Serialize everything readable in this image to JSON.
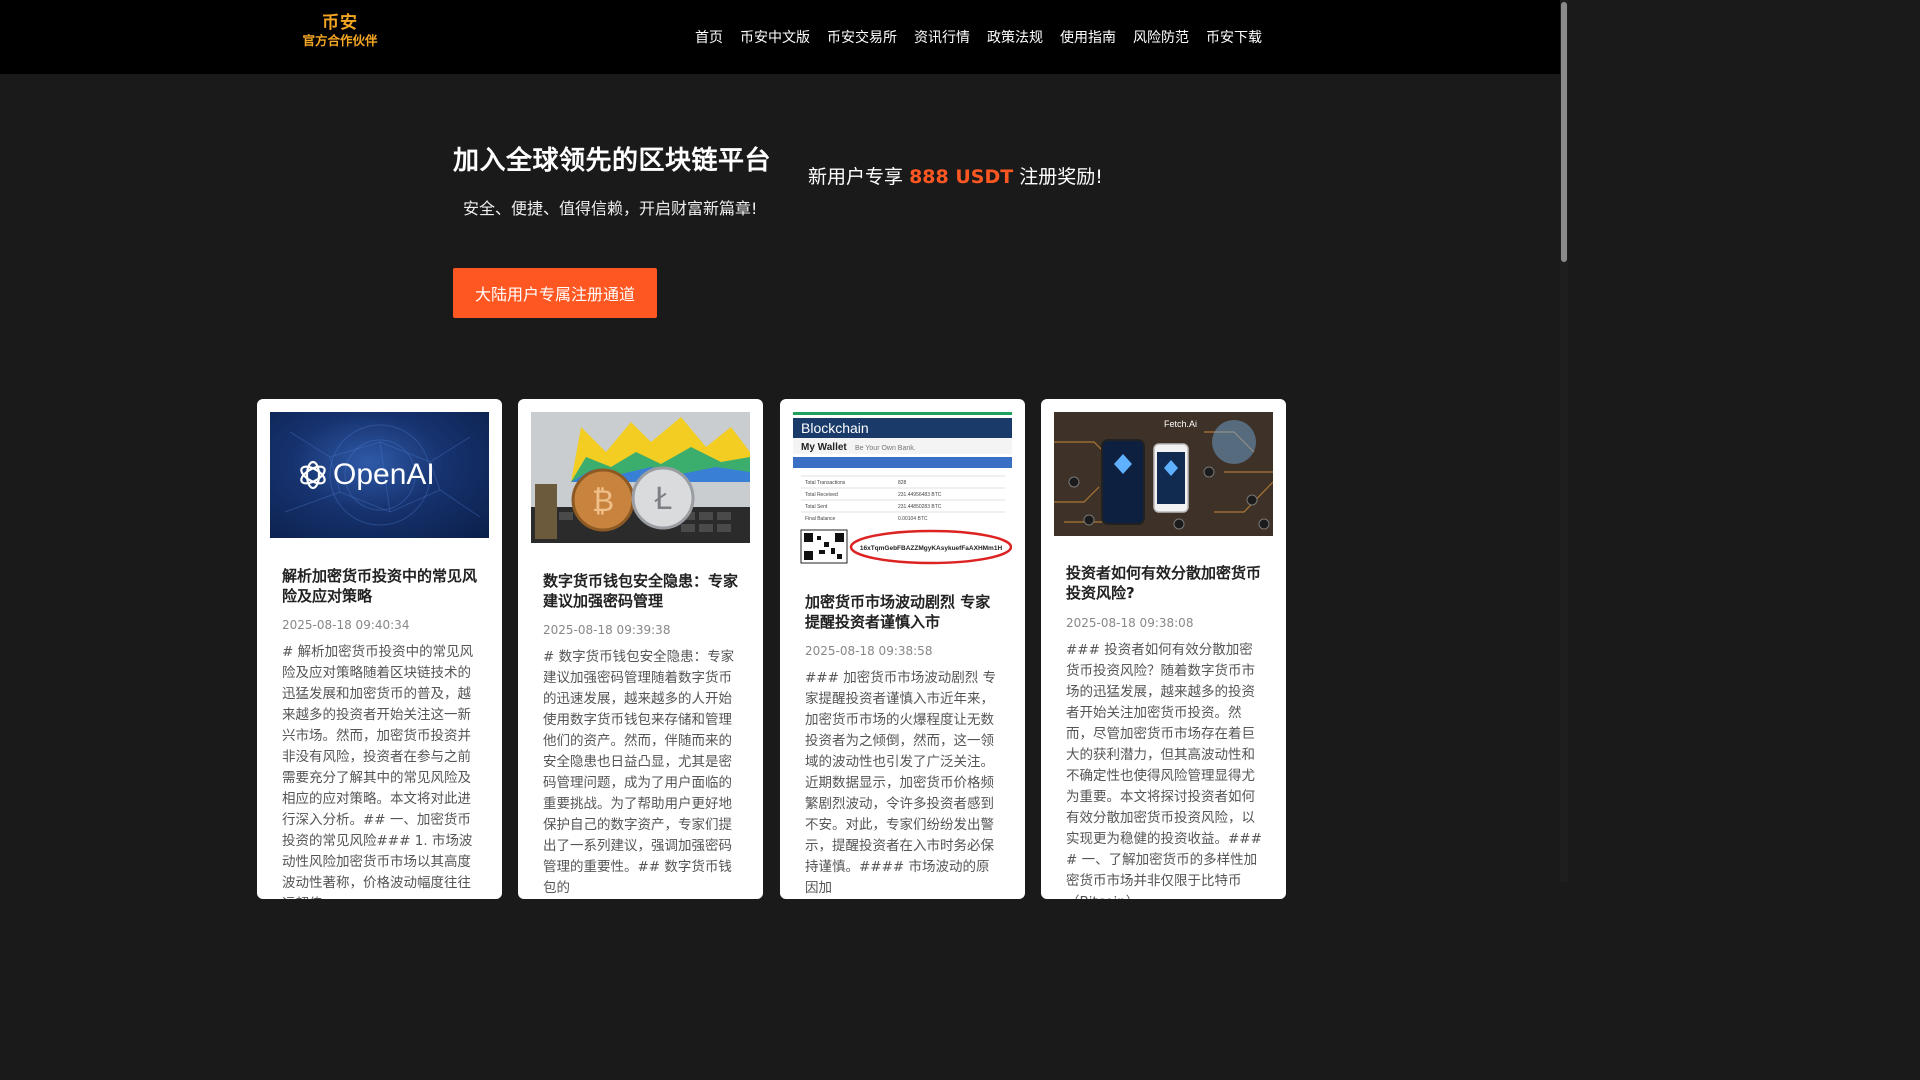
{
  "header": {
    "logo_line1": "币安",
    "logo_line2": "官方合作伙伴",
    "nav": [
      "首页",
      "币安中文版",
      "币安交易所",
      "资讯行情",
      "政策法规",
      "使用指南",
      "风险防范",
      "币安下载"
    ]
  },
  "hero": {
    "title": "加入全球领先的区块链平台",
    "subtitle": "安全、便捷、值得信赖，开启财富新篇章!",
    "promo_prefix": "新用户专享",
    "promo_highlight": "888 USDT",
    "promo_suffix": "注册奖励!",
    "cta_label": "大陆用户专属注册通道"
  },
  "cards": [
    {
      "image_text": "OpenAI",
      "title": "解析加密货币投资中的常见风险及应对策略",
      "date": "2025-08-18 09:40:34",
      "body": "# 解析加密货币投资中的常见风险及应对策略随着区块链技术的迅猛发展和加密货币的普及，越来越多的投资者开始关注这一新兴市场。然而，加密货币投资并非没有风险，投资者在参与之前需要充分了解其中的常见风险及相应的应对策略。本文将对此进行深入分析。## 一、加密货币投资的常见风险### 1. 市场波动性风险加密货币市场以其高度波动性著称，价格波动幅度往往远超传"
    },
    {
      "title": "数字货币钱包安全隐患：专家建议加强密码管理",
      "date": "2025-08-18 09:39:38",
      "body": "# 数字货币钱包安全隐患：专家建议加强密码管理随着数字货币的迅速发展，越来越多的人开始使用数字货币钱包来存储和管理他们的资产。然而，伴随而来的安全隐患也日益凸显，尤其是密码管理问题，成为了用户面临的重要挑战。为了帮助用户更好地保护自己的数字资产，专家们提出了一系列建议，强调加强密码管理的重要性。## 数字货币钱包的"
    },
    {
      "image_text": {
        "brand": "Blockchain",
        "wallet": "My Wallet",
        "tagline": "Be Your Own Bank.",
        "rows": [
          "Total Transactions",
          "Total Received",
          "Total Sent",
          "Final Balance"
        ],
        "vals": [
          "828",
          "231.44956483 BTC",
          "231.44850283 BTC",
          "0.00104 BTC"
        ],
        "address": "16xTqmGebFBAZZMgyKAsykuefFaAXHMm1H"
      },
      "title": "加密货币市场波动剧烈 专家提醒投资者谨慎入市",
      "date": "2025-08-18 09:38:58",
      "body": "### 加密货币市场波动剧烈 专家提醒投资者谨慎入市近年来，加密货币市场的火爆程度让无数投资者为之倾倒，然而，这一领域的波动性也引发了广泛关注。近期数据显示，加密货币价格频繁剧烈波动，令许多投资者感到不安。对此，专家们纷纷发出警示，提醒投资者在入市时务必保持谨慎。#### 市场波动的原因加"
    },
    {
      "image_text": "Fetch.Ai",
      "title": "投资者如何有效分散加密货币投资风险?",
      "date": "2025-08-18 09:38:08",
      "body": "### 投资者如何有效分散加密货币投资风险？随着数字货币市场的迅猛发展，越来越多的投资者开始关注加密货币投资。然而，尽管加密货币市场存在着巨大的获利潜力，但其高波动性和不确定性也使得风险管理显得尤为重要。本文将探讨投资者如何有效分散加密货币投资风险，以实现更为稳健的投资收益。#### 一、了解加密货币的多样性加密货币市场并非仅限于比特币（Bitcoin）"
    }
  ],
  "colors": {
    "accent": "#ff5722",
    "logo": "#f5a623",
    "topbar": "#000000",
    "background": "#1a1a1a"
  }
}
